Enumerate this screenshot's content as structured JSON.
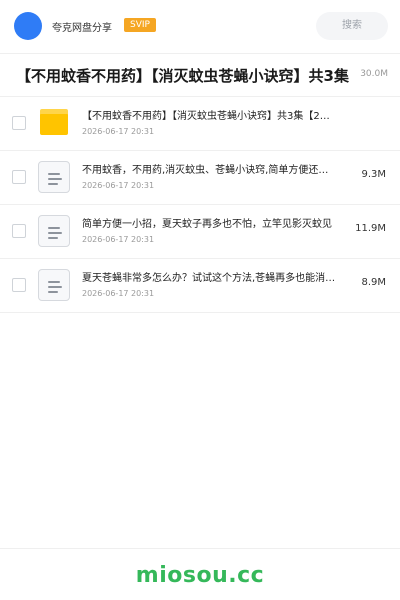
{
  "header": {
    "username": "夸克网盘分享",
    "badge": "SVIP",
    "search_placeholder": "搜索"
  },
  "share": {
    "title": "【不用蚊香不用药】【消灭蚊虫苍蝇小诀窍】共3集",
    "size": "30.0M"
  },
  "files": [
    {
      "type": "folder",
      "name": "【不用蚊香不用药】【消灭蚊虫苍蝇小诀窍】共3集【2…",
      "date": "2026-06-17 20:31",
      "size": ""
    },
    {
      "type": "file",
      "name": "不用蚊香，不用药,消灭蚊虫、苍蝇小诀窍,简单方便还…",
      "date": "2026-06-17 20:31",
      "size": "9.3M"
    },
    {
      "type": "file",
      "name": "简单方便一小招，夏天蚊子再多也不怕，立竿见影灭蚊见",
      "date": "2026-06-17 20:31",
      "size": "11.9M"
    },
    {
      "type": "file",
      "name": "夏天苍蝇非常多怎么办？试试这个方法,苍蝇再多也能消…",
      "date": "2026-06-17 20:31",
      "size": "8.9M"
    }
  ],
  "footer": {
    "brand": "miosou.cc"
  },
  "colors": {
    "avatar": "#2f7cf6",
    "badge": "#f5a623",
    "folder": "#ffc400",
    "brand": "#35b85a"
  },
  "icons": {
    "folder": "folder-icon",
    "file": "document-icon"
  }
}
